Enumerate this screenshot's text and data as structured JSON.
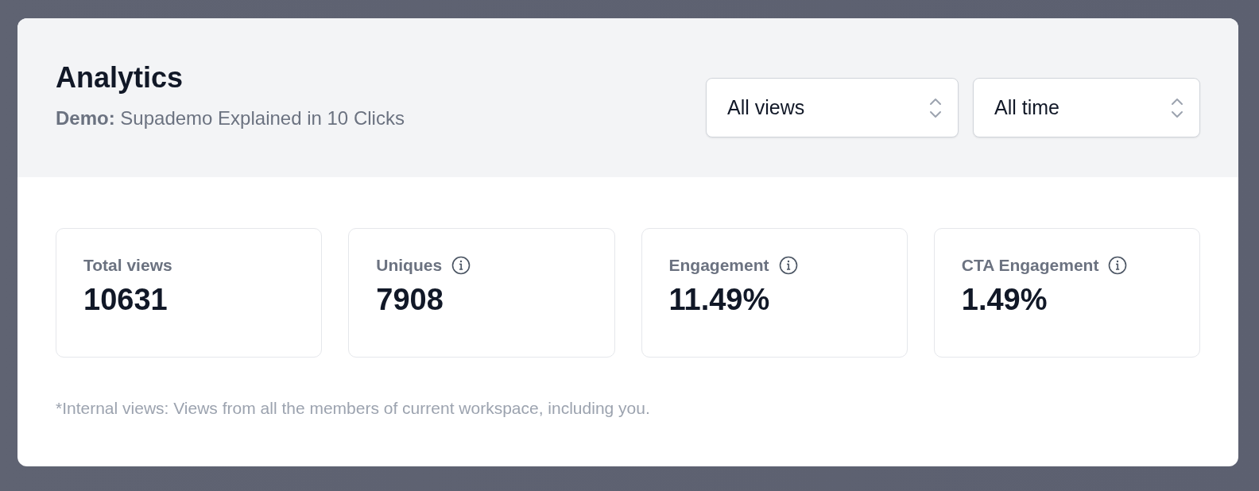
{
  "header": {
    "title": "Analytics",
    "subtitle": "**Demo:** Supademo Explained in 10 Clicks"
  },
  "selects": [
    {
      "value": "All views"
    },
    {
      "value": "All time"
    }
  ],
  "stats": [
    {
      "label": "Total views",
      "value": "10631",
      "info": false
    },
    {
      "label": "Uniques",
      "value": "7908",
      "info": true
    },
    {
      "label": "Engagement",
      "value": "11.49%",
      "info": true
    },
    {
      "label": "CTA Engagement",
      "value": "1.49%",
      "info": true
    }
  ],
  "footnote": "*Internal views: Views from all the members of current workspace, including you."
}
